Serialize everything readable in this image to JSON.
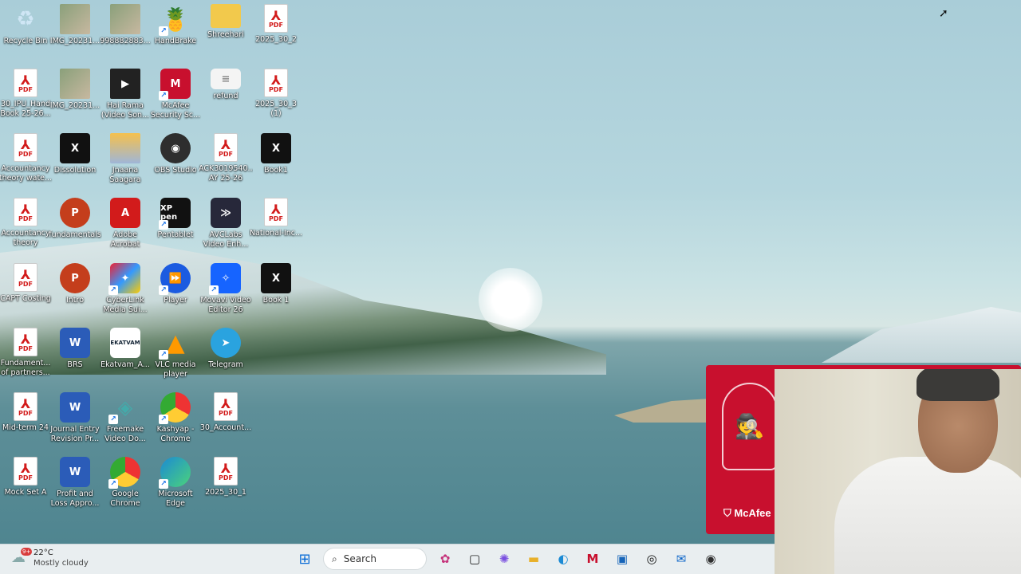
{
  "desktop_icons": [
    {
      "label": "Recycle Bin",
      "glyph": "♻"
    },
    {
      "label": "IMG_20231...",
      "glyph": ""
    },
    {
      "label": "998882883...",
      "glyph": ""
    },
    {
      "label": "HandBrake",
      "glyph": "🍍"
    },
    {
      "label": "Shreehari",
      "glyph": ""
    },
    {
      "label": "2025_30_2",
      "glyph": "PDF"
    },
    {
      "label": "30_IPU_Hand Book 25-26...",
      "glyph": "PDF"
    },
    {
      "label": "IMG_20231...",
      "glyph": ""
    },
    {
      "label": "Hai Rama (Video Son...",
      "glyph": "▶"
    },
    {
      "label": "McAfee Security Sc...",
      "glyph": "M"
    },
    {
      "label": "refund",
      "glyph": "≡"
    },
    {
      "label": "2025_30_3 (1)",
      "glyph": "PDF"
    },
    {
      "label": "Accountancy theory wate...",
      "glyph": "PDF"
    },
    {
      "label": "Dissolution",
      "glyph": "X"
    },
    {
      "label": "Jnaana Saagara",
      "glyph": ""
    },
    {
      "label": "OBS Studio",
      "glyph": "◉"
    },
    {
      "label": "ACK3019540... AY 25-26",
      "glyph": "PDF"
    },
    {
      "label": "Book1",
      "glyph": "X"
    },
    {
      "label": "Accountancy theory",
      "glyph": "PDF"
    },
    {
      "label": "fundamentals",
      "glyph": "P"
    },
    {
      "label": "Adobe Acrobat",
      "glyph": "A"
    },
    {
      "label": "Pentablet",
      "glyph": "XP pen"
    },
    {
      "label": "AVCLabs Video Enh...",
      "glyph": "≫"
    },
    {
      "label": "National-Inc...",
      "glyph": "PDF"
    },
    {
      "label": "CAPT Costing",
      "glyph": "PDF"
    },
    {
      "label": "Intro",
      "glyph": "P"
    },
    {
      "label": "CyberLink Media Sui...",
      "glyph": "✦"
    },
    {
      "label": "Player",
      "glyph": "⏩"
    },
    {
      "label": "Movavi Video Editor 26",
      "glyph": "✧"
    },
    {
      "label": "Book 1",
      "glyph": "X"
    },
    {
      "label": "Fundament... of partners...",
      "glyph": "PDF"
    },
    {
      "label": "BRS",
      "glyph": "W"
    },
    {
      "label": "Ekatvam_A...",
      "glyph": "EKATVAM"
    },
    {
      "label": "VLC media player",
      "glyph": "▲"
    },
    {
      "label": "Telegram",
      "glyph": "➤"
    },
    {
      "label": "Mid-term 24",
      "glyph": "PDF"
    },
    {
      "label": "Journal Entry Revision Pr...",
      "glyph": "W"
    },
    {
      "label": "Freemake Video Do...",
      "glyph": "◈"
    },
    {
      "label": "Kashyap - Chrome",
      "glyph": ""
    },
    {
      "label": "30_Account...",
      "glyph": "PDF"
    },
    {
      "label": "Mock Set A",
      "glyph": "PDF"
    },
    {
      "label": "Profit and Loss Appro...",
      "glyph": "W"
    },
    {
      "label": "Google Chrome",
      "glyph": ""
    },
    {
      "label": "Microsoft Edge",
      "glyph": ""
    },
    {
      "label": "2025_30_1",
      "glyph": "PDF"
    }
  ],
  "mcafee": {
    "brand": "McAfee",
    "art_icon": "🕵"
  },
  "taskbar": {
    "weather": {
      "badge": "9+",
      "temp": "22°C",
      "condition": "Mostly cloudy",
      "icon": "cloud-icon"
    },
    "start_glyph": "⊞",
    "search_placeholder": "Search",
    "search_glyph": "⌕",
    "apps": [
      {
        "name": "widgets-icon",
        "glyph": "✿"
      },
      {
        "name": "task-view-icon",
        "glyph": "▢"
      },
      {
        "name": "copilot-icon",
        "glyph": "✺"
      },
      {
        "name": "file-explorer-icon",
        "glyph": "▬"
      },
      {
        "name": "edge-icon",
        "glyph": "◐"
      },
      {
        "name": "mcafee-icon",
        "glyph": "M"
      },
      {
        "name": "store-icon",
        "glyph": "▣"
      },
      {
        "name": "dell-icon",
        "glyph": "◎"
      },
      {
        "name": "outlook-icon",
        "glyph": "✉"
      },
      {
        "name": "obs-icon",
        "glyph": "◉"
      }
    ]
  },
  "colors": {
    "mcafee_red": "#c8102e",
    "taskbar_bg": "#e9eef0"
  }
}
